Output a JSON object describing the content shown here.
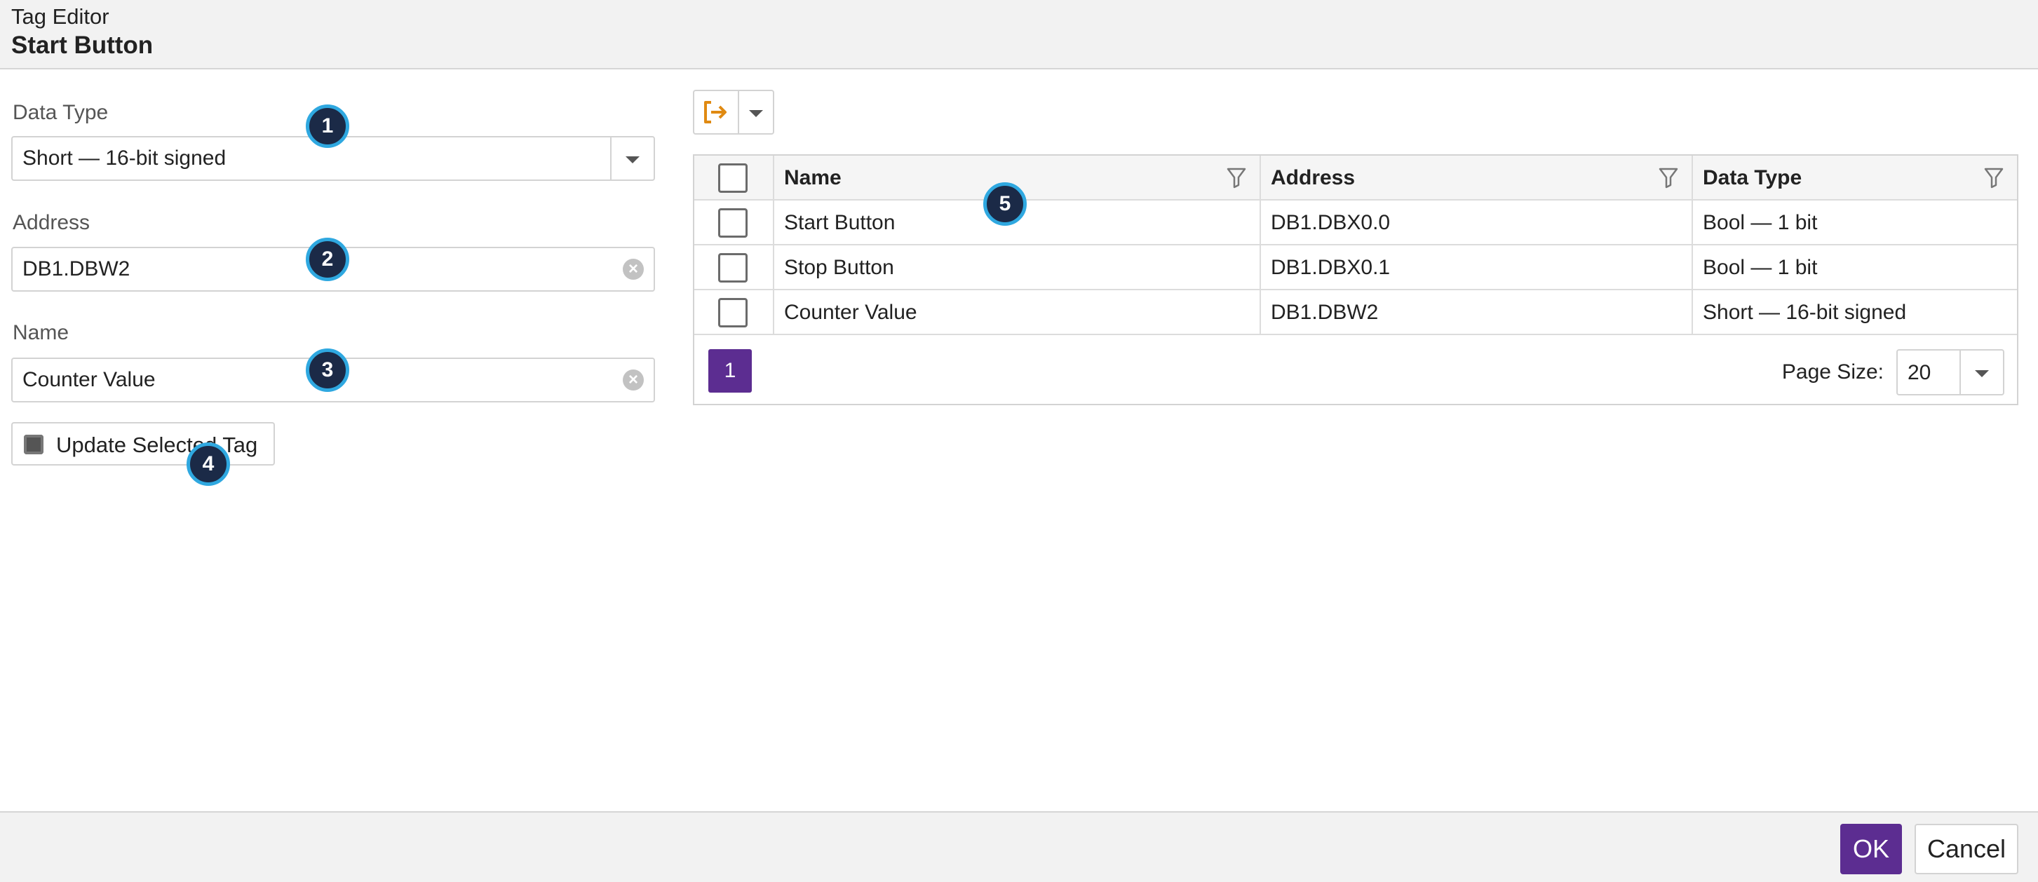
{
  "header": {
    "app_title": "Tag Editor",
    "tag_title": "Start Button"
  },
  "form": {
    "data_type": {
      "label": "Data Type",
      "value": "Short — 16-bit signed"
    },
    "address": {
      "label": "Address",
      "value": "DB1.DBW2"
    },
    "name": {
      "label": "Name",
      "value": "Counter Value"
    },
    "update_button": "Update Selected Tag"
  },
  "grid": {
    "columns": [
      "Name",
      "Address",
      "Data Type"
    ],
    "rows": [
      {
        "name": "Start Button",
        "address": "DB1.DBX0.0",
        "type": "Bool — 1 bit"
      },
      {
        "name": "Stop Button",
        "address": "DB1.DBX0.1",
        "type": "Bool — 1 bit"
      },
      {
        "name": "Counter Value",
        "address": "DB1.DBW2",
        "type": "Short — 16-bit signed"
      }
    ],
    "pager": {
      "current_page": "1",
      "page_size_label": "Page Size:",
      "page_size": "20"
    }
  },
  "footer": {
    "ok": "OK",
    "cancel": "Cancel"
  },
  "markers": [
    "1",
    "2",
    "3",
    "4",
    "5"
  ],
  "icons": {
    "export": "export-icon",
    "filter": "filter-icon",
    "clear": "clear-icon",
    "dropdown": "chevron-down-icon",
    "chip": "chip-icon"
  },
  "colors": {
    "accent": "#5c2d91",
    "export_icon": "#e08a12",
    "marker_fill": "#1b2a47",
    "marker_ring": "#2fa8e0",
    "header_bg": "#f2f2f2",
    "border": "#d3d3d3"
  }
}
